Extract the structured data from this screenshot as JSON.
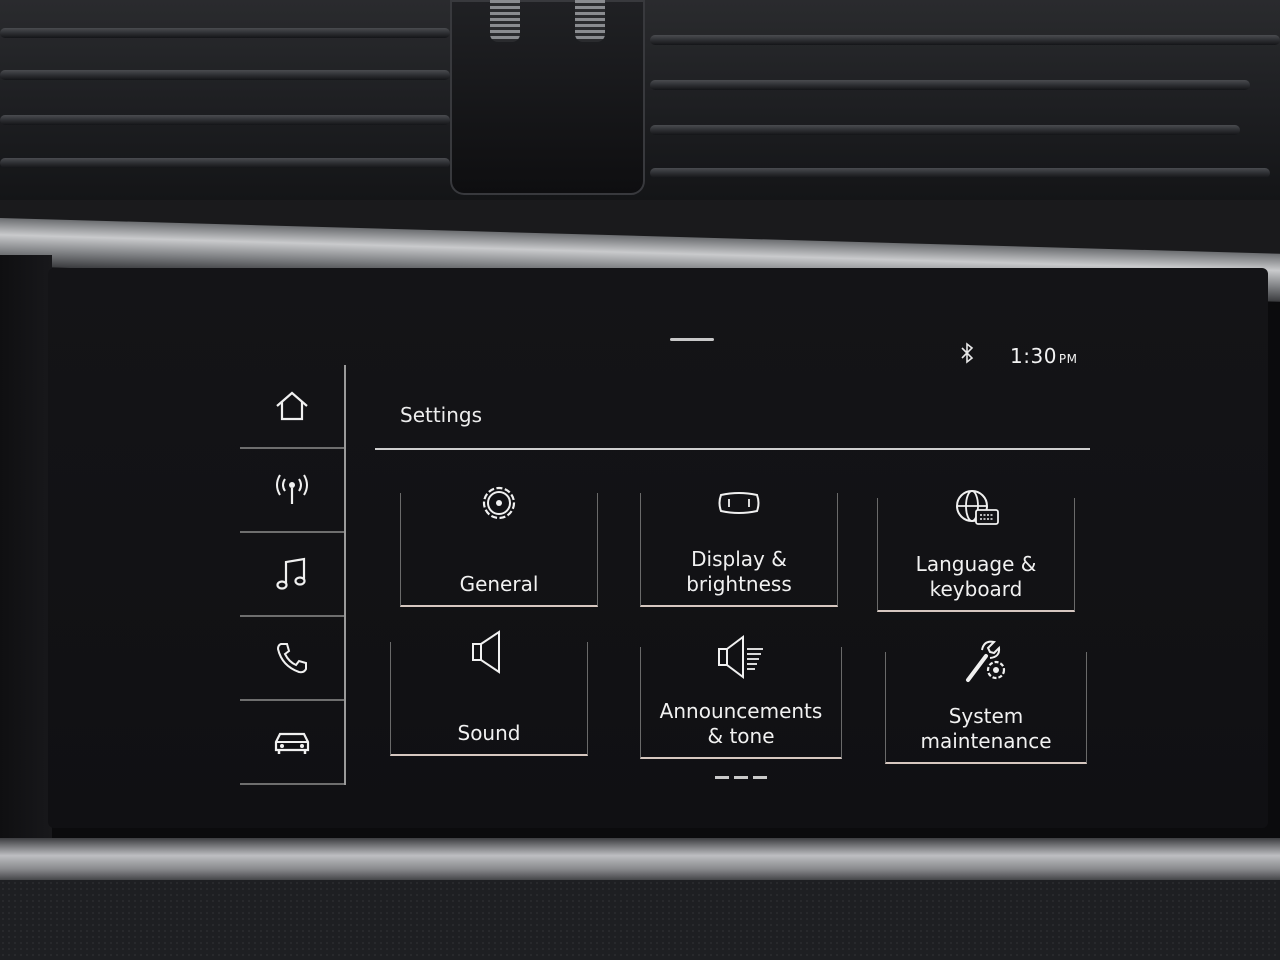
{
  "status_bar": {
    "time": "1:30",
    "time_suffix": "PM",
    "bluetooth_icon": "bluetooth-icon"
  },
  "nav_rail": {
    "items": [
      {
        "icon": "home-icon"
      },
      {
        "icon": "radio-icon"
      },
      {
        "icon": "music-icon"
      },
      {
        "icon": "phone-icon"
      },
      {
        "icon": "car-icon"
      }
    ]
  },
  "page": {
    "title": "Settings"
  },
  "tiles": [
    {
      "label": "General",
      "icon": "gear-icon"
    },
    {
      "label": "Display &\nbrightness",
      "icon": "display-icon"
    },
    {
      "label": "Language &\nkeyboard",
      "icon": "globe-keyboard-icon"
    },
    {
      "label": "Sound",
      "icon": "speaker-icon"
    },
    {
      "label": "Announcements\n& tone",
      "icon": "speaker-tone-icon"
    },
    {
      "label": "System\nmaintenance",
      "icon": "wrench-gear-icon"
    }
  ],
  "pager": {
    "pages": 3,
    "current": 1
  }
}
